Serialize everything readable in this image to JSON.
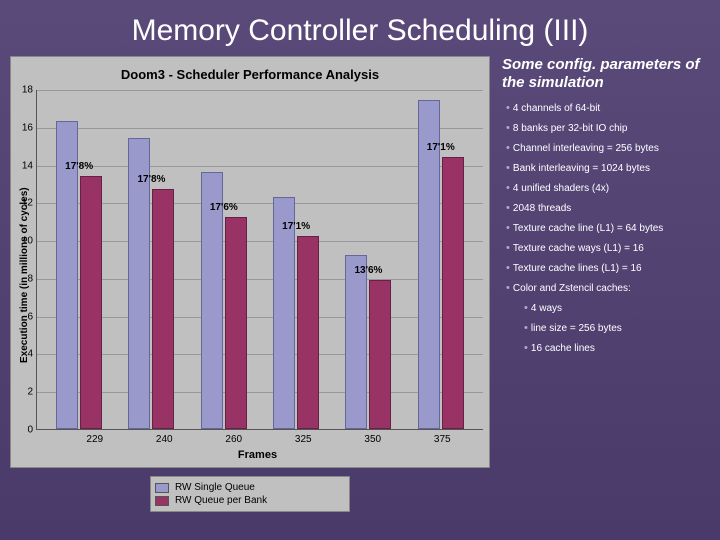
{
  "slide": {
    "title": "Memory Controller Scheduling (III)"
  },
  "chart_data": {
    "type": "bar",
    "title": "Doom3 - Scheduler Performance Analysis",
    "xlabel": "Frames",
    "ylabel": "Execution time (in millions of cycles)",
    "ylim": [
      0,
      18
    ],
    "yticks": [
      0,
      2,
      4,
      6,
      8,
      10,
      12,
      14,
      16,
      18
    ],
    "categories": [
      "229",
      "240",
      "260",
      "325",
      "350",
      "375"
    ],
    "series": [
      {
        "name": "RW Single Queue",
        "values": [
          16.3,
          15.4,
          13.6,
          12.3,
          9.2,
          17.4
        ]
      },
      {
        "name": "RW Queue per Bank",
        "values": [
          13.4,
          12.7,
          11.2,
          10.2,
          7.9,
          14.4
        ]
      }
    ],
    "data_labels": [
      "17'8%",
      "17'8%",
      "17'6%",
      "17'1%",
      "13'6%",
      "17'1%"
    ],
    "legend": {
      "single": "RW Single Queue",
      "perbank": "RW Queue per Bank"
    }
  },
  "side": {
    "title": "Some config. parameters of the simulation",
    "bullets": [
      "4 channels of 64-bit",
      "8 banks per 32-bit IO chip",
      "Channel interleaving = 256 bytes",
      "Bank interleaving = 1024 bytes",
      "4 unified shaders (4x)",
      "2048 threads",
      "Texture cache line (L1) =  64 bytes",
      "Texture cache ways (L1) = 16",
      "Texture cache lines (L1) = 16",
      "Color and Zstencil caches:"
    ],
    "sub_bullets": [
      "4 ways",
      "line size = 256 bytes",
      "16 cache lines"
    ]
  }
}
